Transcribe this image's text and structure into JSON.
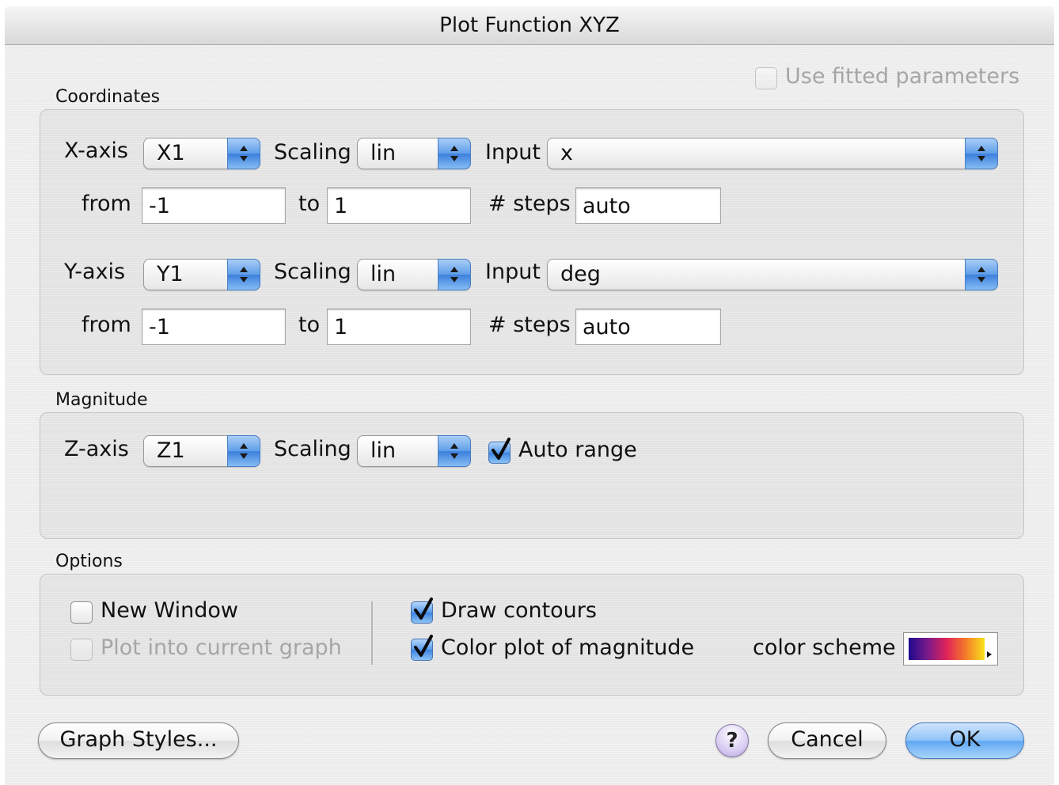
{
  "window": {
    "title": "Plot Function XYZ"
  },
  "use_fitted": {
    "label": "Use fitted parameters",
    "checked": false,
    "enabled": false
  },
  "coordinates": {
    "title": "Coordinates",
    "x": {
      "axis_label": "X-axis",
      "axis_value": "X1",
      "scaling_label": "Scaling",
      "scaling_value": "lin",
      "input_label": "Input",
      "input_value": "x",
      "from_label": "from",
      "from_value": "-1",
      "to_label": "to",
      "to_value": "1",
      "steps_label": "# steps",
      "steps_value": "auto"
    },
    "y": {
      "axis_label": "Y-axis",
      "axis_value": "Y1",
      "scaling_label": "Scaling",
      "scaling_value": "lin",
      "input_label": "Input",
      "input_value": "deg",
      "from_label": "from",
      "from_value": "-1",
      "to_label": "to",
      "to_value": "1",
      "steps_label": "# steps",
      "steps_value": "auto"
    }
  },
  "magnitude": {
    "title": "Magnitude",
    "axis_label": "Z-axis",
    "axis_value": "Z1",
    "scaling_label": "Scaling",
    "scaling_value": "lin",
    "auto_range_label": "Auto range",
    "auto_range_checked": true
  },
  "options": {
    "title": "Options",
    "new_window_label": "New Window",
    "new_window_checked": false,
    "plot_into_label": "Plot into current graph",
    "plot_into_checked": false,
    "plot_into_enabled": false,
    "draw_contours_label": "Draw contours",
    "draw_contours_checked": true,
    "color_plot_label": "Color plot of magnitude",
    "color_plot_checked": true,
    "color_scheme_label": "color scheme",
    "color_scheme_colors": [
      "#1c0a8c",
      "#7a1a8a",
      "#e0235a",
      "#f57a2a",
      "#f7e21a"
    ]
  },
  "buttons": {
    "graph_styles": "Graph Styles...",
    "help": "?",
    "cancel": "Cancel",
    "ok": "OK"
  }
}
